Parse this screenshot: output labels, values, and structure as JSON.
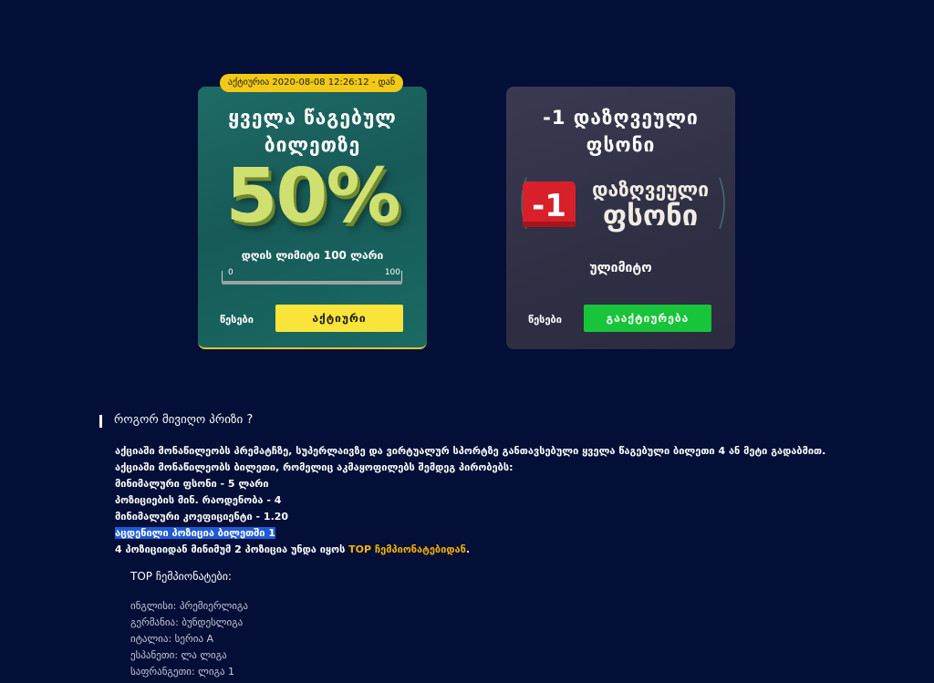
{
  "cards": {
    "first": {
      "badge": "აქტიურია 2020-08-08 12:26:12 - დან",
      "title_line1": "ყველა წაგებულ",
      "title_line2": "ბილეთზე",
      "percent": "50%",
      "limit_text": "დღის ლიმიტი 100 ლარი",
      "range_min": "0",
      "range_max": "100",
      "progress": 0,
      "rules_label": "წესები",
      "action_label": "აქტიური"
    },
    "second": {
      "title_line1": "-1 დაზღვეული",
      "title_line2": "ფსონი",
      "logo_number": "-1",
      "logo_line1": "დაზღვეული",
      "logo_line2": "ფსონი",
      "unlimited": "ულიმიტო",
      "rules_label": "წესები",
      "action_label": "გააქტიურება"
    }
  },
  "section": {
    "title": "როგორ მივიღო პრიზი ?",
    "lines": [
      "აქციაში მონაწილეობს პრემატჩზე, სუპერლაივზე და ვირტუალურ სპორტზე განთავსებული ყველა წაგებული ბილეთი 4 ან მეტი გადაბმით.",
      "აქციაში მონაწილეობს ბილეთი, რომელიც აკმაყოფილებს შემდეგ პირობებს:",
      "მინიმალური ფსონი - 5 ლარი",
      "პოზიციების მინ. რაოდენობა - 4",
      "მინიმალური კოეფიციენტი - 1.20",
      "აცდენილი პოზიცია ბილეთში 1"
    ],
    "last_line_prefix": "4 პოზიციიდან მინიმუმ 2 პოზიცია უნდა იყოს ",
    "last_line_highlight": "TOP ჩემპიონატებიდან",
    "last_line_suffix": ".",
    "champ_title": "TOP ჩემპიონატები:",
    "champs": [
      "ინგლისი: პრემიერლიგა",
      "გერმანია: ბუნდესლიგა",
      "იტალია: სერია A",
      "ესპანეთი: ლა ლიგა",
      "საფრანგეთი: ლიგა 1"
    ]
  }
}
